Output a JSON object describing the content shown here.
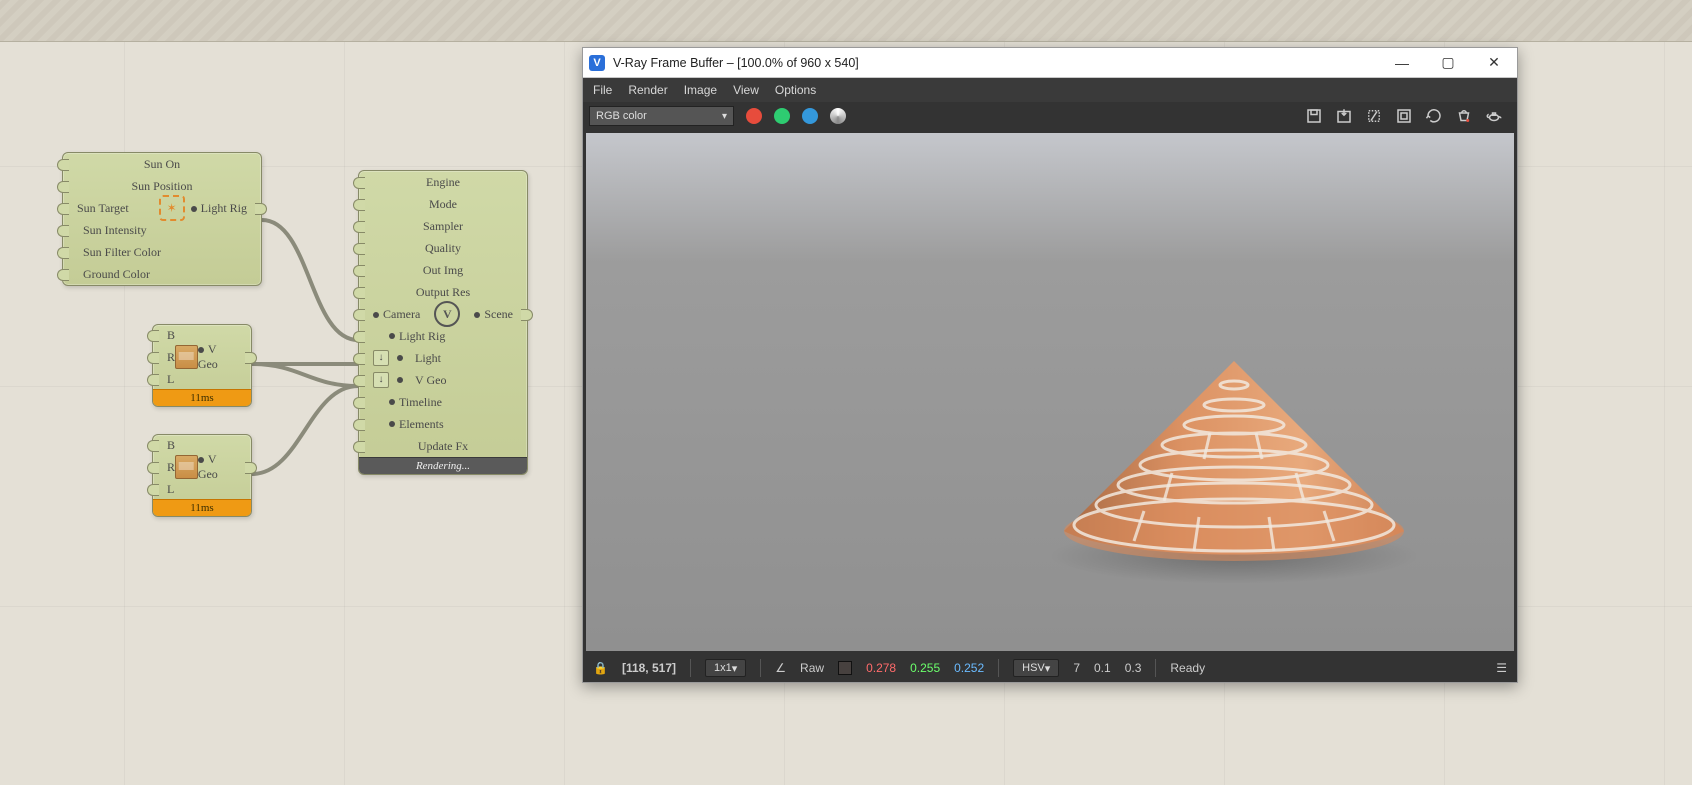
{
  "canvas": {
    "sun_node": {
      "rows": [
        "Sun On",
        "Sun Position",
        "Sun Target",
        "Sun Intensity",
        "Sun Filter Color",
        "Ground Color"
      ],
      "output_label": "Light Rig"
    },
    "vgeo1": {
      "inputs": [
        "B",
        "R",
        "L"
      ],
      "output": "V Geo",
      "time": "11ms"
    },
    "vgeo2": {
      "inputs": [
        "B",
        "R",
        "L"
      ],
      "output": "V Geo",
      "time": "11ms"
    },
    "render_node": {
      "rows": [
        "Engine",
        "Mode",
        "Sampler",
        "Quality",
        "Out Img",
        "Output Res"
      ],
      "camera": "Camera",
      "scene": "Scene",
      "lightrig": "Light Rig",
      "light": "Light",
      "vgeo": "V Geo",
      "timeline": "Timeline",
      "elements": "Elements",
      "updatefx": "Update Fx",
      "footer": "Rendering..."
    }
  },
  "vfb": {
    "title": "V-Ray Frame Buffer – [100.0% of 960 x 540]",
    "menu": [
      "File",
      "Render",
      "Image",
      "View",
      "Options"
    ],
    "channel_dropdown": "RGB color",
    "status": {
      "coords": "[118, 517]",
      "zoom": "1x1",
      "raw": "Raw",
      "r": "0.278",
      "g": "0.255",
      "b": "0.252",
      "mode": "HSV",
      "h": "7",
      "s": "0.1",
      "v": "0.3",
      "msg": "Ready"
    }
  }
}
